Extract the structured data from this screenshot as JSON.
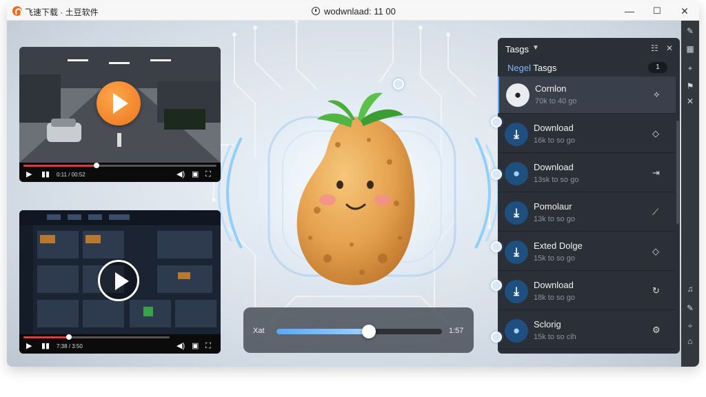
{
  "window": {
    "app_name": "飞速下载 · 土豆软件",
    "title": "wodwnlaad: 11 00",
    "controls": {
      "minimize": "—",
      "maximize": "☐",
      "close": "✕"
    }
  },
  "players": [
    {
      "name": "road-video",
      "progress": 0.38,
      "time_text": "0:11 / 00:52"
    },
    {
      "name": "interface-video",
      "progress": 0.31,
      "time_text": "7:38 / 3:50"
    }
  ],
  "slider": {
    "left_label": "Xat",
    "right_label": "1:57",
    "value": 0.56
  },
  "tags_panel": {
    "title": "Tasgs",
    "subheader_accent": "Negel",
    "subheader_label": "Tasgs",
    "count_badge": "1",
    "items": [
      {
        "name": "Cornlon",
        "meta": "70k to 40 go",
        "icon": "potato-icon",
        "action": "⟡",
        "active": true
      },
      {
        "name": "Download",
        "meta": "16k to so go",
        "icon": "download-icon",
        "action": "◇",
        "active": false
      },
      {
        "name": "Download",
        "meta": "13sk to so go",
        "icon": "drop-icon",
        "action": "⇥",
        "active": false
      },
      {
        "name": "Pomolaur",
        "meta": "13k to so go",
        "icon": "download-icon",
        "action": "⟋",
        "active": false
      },
      {
        "name": "Exted Dolge",
        "meta": "15k to so go",
        "icon": "download-icon",
        "action": "◇",
        "active": false
      },
      {
        "name": "Download",
        "meta": "18k to so go",
        "icon": "download-icon",
        "action": "↻",
        "active": false
      },
      {
        "name": "Sclorig",
        "meta": "15k to so cih",
        "icon": "drop-icon",
        "action": "⚙",
        "active": false
      }
    ]
  },
  "colors": {
    "accent": "#5aa8ff",
    "panel_bg": "#2a2f38",
    "player_progress": "#e23b3b",
    "logo": "#f26b1d"
  }
}
